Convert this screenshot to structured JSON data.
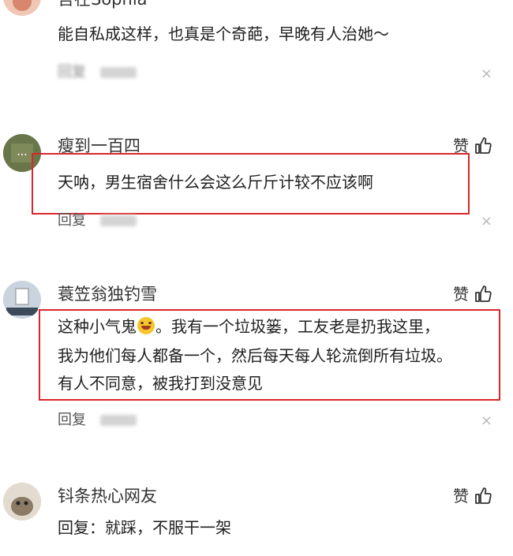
{
  "comments": [
    {
      "username": "吾在Sophia",
      "lines": [
        "能自私成这样，也真是个奇葩，早晚有人治她～"
      ],
      "reply_label": "回复",
      "close_symbol": "×"
    },
    {
      "username": "瘦到一百四",
      "like_label": "赞",
      "lines": [
        "天呐，男生宿舍什么会这么斤斤计较不应该啊"
      ],
      "reply_label": "回复",
      "close_symbol": "×"
    },
    {
      "username": "蓑笠翁独钓雪",
      "like_label": "赞",
      "lines_part_a": "这种小气鬼",
      "lines_part_b": "。我有一个垃圾篓，工友老是扔我这里，",
      "lines": [
        "我为他们每人都备一个，然后每天每人轮流倒所有垃圾。",
        "有人不同意，被我打到没意见"
      ],
      "reply_label": "回复",
      "close_symbol": "×"
    },
    {
      "username": "钭条热心网友",
      "like_label": "赞",
      "lines": [
        "回复：就踩，不服干一架"
      ]
    }
  ],
  "icons": {
    "thumbs_up": "thumbs-up-icon",
    "close": "close-icon",
    "emoji": "laughing-emoji-icon"
  },
  "colors": {
    "highlight_border": "#d9262c",
    "text": "#1f1f1f",
    "muted": "#b9b9b9"
  }
}
